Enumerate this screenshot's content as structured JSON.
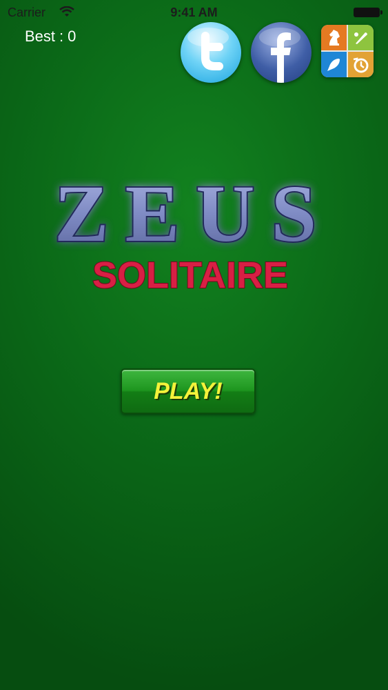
{
  "status_bar": {
    "carrier": "Carrier",
    "time": "9:41 AM"
  },
  "score": {
    "best_label": "Best",
    "separator": ":",
    "best_value": "0"
  },
  "title": {
    "line1": "ZEUS",
    "line2": "SOLITAIRE"
  },
  "play_button": {
    "label": "PLAY!"
  },
  "icons": {
    "twitter": "twitter-icon",
    "facebook": "facebook-icon",
    "game_center": "game-center-icon"
  },
  "colors": {
    "felt_green": "#0b6a18",
    "title_blue": "#7f8bc4",
    "title_red": "#d81f44",
    "play_text": "#f4f23a"
  }
}
